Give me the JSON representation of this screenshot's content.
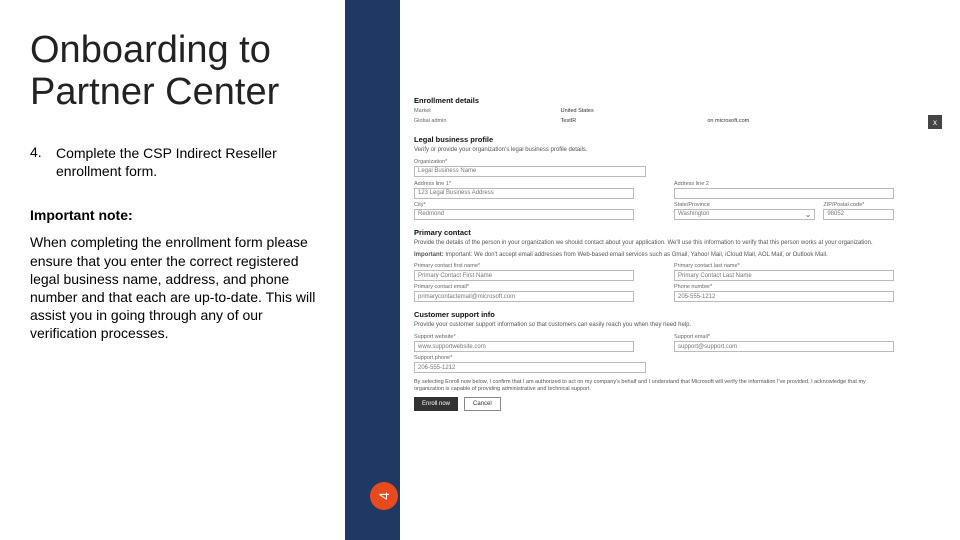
{
  "title": "Onboarding to Partner Center",
  "step": {
    "num": "4.",
    "text": "Complete the CSP Indirect Reseller enrollment form."
  },
  "note": {
    "head": "Important note:",
    "body": "When completing the enrollment form please ensure that you enter the correct registered legal business name, address, and phone number and that each are up-to-date. This will assist you in going through any of our verification processes."
  },
  "page_number": "4",
  "form": {
    "close": "x",
    "enroll_head": "Enrollment details",
    "market_lbl": "Market",
    "market_val": "United States",
    "admin_lbl": "Global admin",
    "admin_val": "TestIR",
    "admin_email": "on microsoft.com",
    "legal_head": "Legal business profile",
    "legal_sub": "Verify or provide your organization's legal business profile details.",
    "org_lbl": "Organization*",
    "org_ph": "Legal Business Name",
    "addr1_lbl": "Address line 1*",
    "addr1_ph": "123 Legal Business Address",
    "addr2_lbl": "Address line 2",
    "city_lbl": "City*",
    "city_ph": "Redmond",
    "state_lbl": "State/Province",
    "state_val": "Washington",
    "zip_lbl": "ZIP/Postal code*",
    "zip_val": "98052",
    "primary_head": "Primary contact",
    "primary_sub1": "Provide the details of the person in your organization we should contact about your application. We'll use this information to verify that this person works at your organization.",
    "primary_sub2": "Important: We don't accept email addresses from Web-based email services such as Gmail, Yahoo! Mail, iCloud Mail, AOL Mail, or Outlook Mail.",
    "pc_first_lbl": "Primary contact first name*",
    "pc_first_ph": "Primary Contact First Name",
    "pc_last_lbl": "Primary contact last name*",
    "pc_last_ph": "Primary Contact Last Name",
    "pc_email_lbl": "Primary contact email*",
    "pc_email_ph": "primarycontactemail@microsoft.com",
    "pc_phone_lbl": "Phone number*",
    "pc_phone_ph": "205-555-1212",
    "support_head": "Customer support info",
    "support_sub": "Provide your customer support information so that customers can easily reach you when they need help.",
    "sw_lbl": "Support website*",
    "sw_ph": "www.supportwebsite.com",
    "se_lbl": "Support email*",
    "se_ph": "support@support.com",
    "sp_lbl": "Support phone*",
    "sp_ph": "206-555-1212",
    "disclaimer": "By selecting Enroll now below, I confirm that I am authorized to act on my company's behalf and I understand that Microsoft will verify the information I've provided. I acknowledge that my organization is capable of providing administrative and technical support.",
    "btn_enroll": "Enroll now",
    "btn_cancel": "Cancel"
  }
}
